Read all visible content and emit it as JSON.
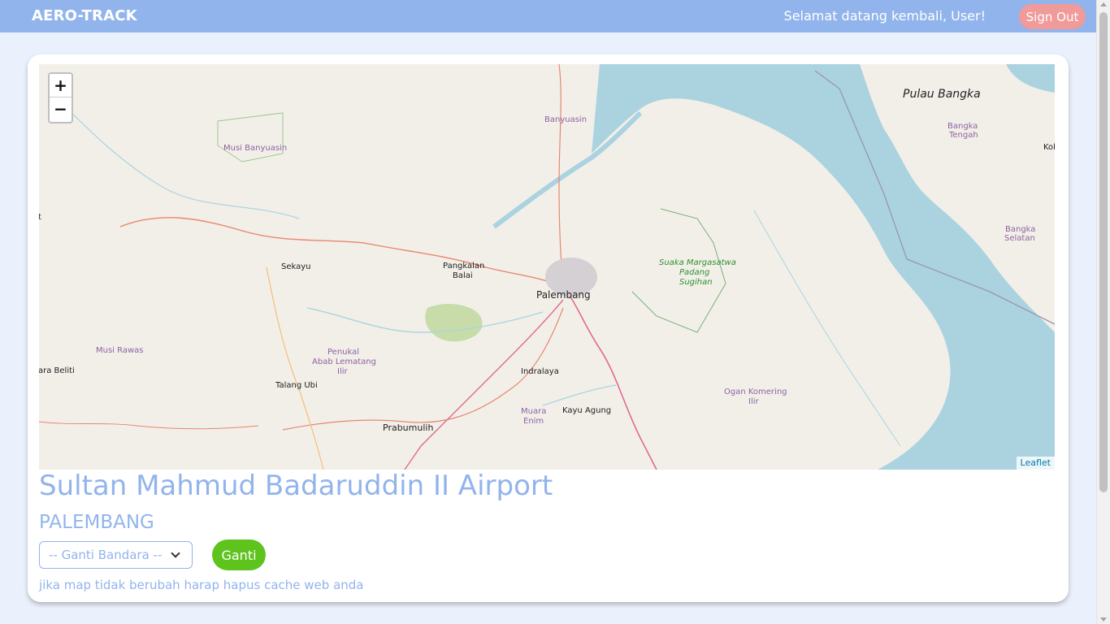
{
  "navbar": {
    "brand": "AERO-TRACK",
    "welcome": "Selamat datang kembali, User!",
    "signout_label": "Sign Out"
  },
  "map": {
    "zoom_in": "+",
    "zoom_out": "−",
    "attribution": "Leaflet",
    "labels": {
      "pulau_bangka": "Pulau Bangka",
      "banyuasin": "Banyuasin",
      "bangka_tengah_1": "Bangka",
      "bangka_tengah_2": "Tengah",
      "kol": "Kol",
      "musi_banyuasin": "Musi Banyuasin",
      "bangka_selatan_1": "Bangka",
      "bangka_selatan_2": "Selatan",
      "sekayu": "Sekayu",
      "pangkalan_1": "Pangkalan",
      "pangkalan_2": "Balai",
      "suaka_1": "Suaka Margasatwa",
      "suaka_2": "Padang",
      "suaka_3": "Sugihan",
      "palembang": "Palembang",
      "musi_rawas": "Musi Rawas",
      "penukal_1": "Penukal",
      "penukal_2": "Abab Lematang",
      "penukal_3": "Ilir",
      "ara_beliti": "ara Beliti",
      "indralaya": "Indralaya",
      "talang_ubi": "Talang Ubi",
      "ogan_1": "Ogan Komering",
      "ogan_2": "Ilir",
      "muara_1": "Muara",
      "muara_2": "Enim",
      "kayu_agung": "Kayu Agung",
      "prabumulih": "Prabumulih",
      "t_edge": "t"
    }
  },
  "airport": {
    "name": "Sultan Mahmud Badaruddin II Airport",
    "city": "PALEMBANG"
  },
  "form": {
    "select_placeholder": "-- Ganti Bandara --",
    "ganti_label": "Ganti",
    "note": "jika map tidak berubah harap hapus cache web anda"
  },
  "colors": {
    "navbar": "#92b4ec",
    "signout": "#f09a9a",
    "ganti": "#5fc31e",
    "sea": "#aad3df",
    "land": "#f2efe9"
  }
}
